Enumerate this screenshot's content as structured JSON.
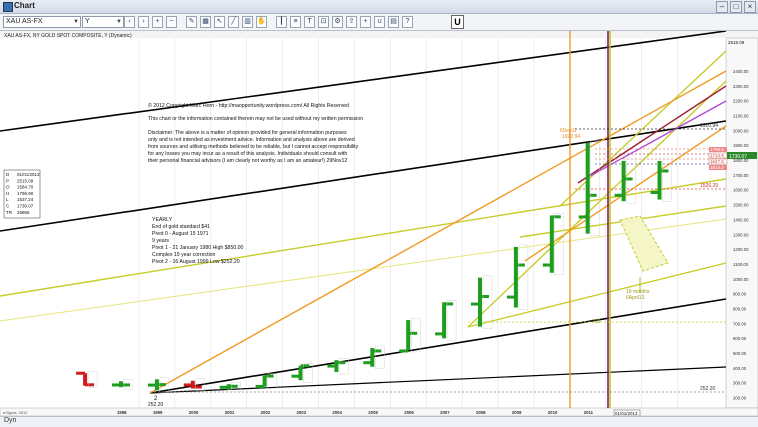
{
  "window": {
    "title": "Chart"
  },
  "toolbar": {
    "symbol": "XAU AS-FX",
    "period": "Y",
    "u_label": "U"
  },
  "chart": {
    "header": "XAU AS-FX, NY GOLD SPOT COMPOSITE, Y (Dynamic)",
    "copyright": [
      "© 2012 Copyright Marc Horn - http://maopportunity.wordpress.com/  All Rights Reserved",
      "This chart or the information contained therein may not be used without my written permission",
      "Disclaimer: The above is a matter of opinion provided for general information purposes",
      "only and is not intended as investment advice. Information and analysis above are derived",
      "from sources and utilising methods believed to be reliable, but I cannot accept responsibility",
      "for any losses you may incur as a result of this analysis. Individuals should consult with",
      "their personal financial advisors (I am clearly not worthy as I am an amateur!)    29Nov12"
    ],
    "notes": [
      "YEARLY",
      "End of gold standard $41",
      "Pivot 0 - August 15 1971",
      "9 years",
      "Pivot 1 - 21 January 1980 High $850.00",
      "Complex 19 year correction",
      "Pivot 2 - 16 August 1999 Low $252.20"
    ],
    "data_box": [
      {
        "k": "D",
        "v": "01/01/2013"
      },
      {
        "k": "P",
        "v": "2515.09"
      },
      {
        "k": "O",
        "v": "1584.70"
      },
      {
        "k": "H",
        "v": "1796.90"
      },
      {
        "k": "L",
        "v": "1537.24"
      },
      {
        "k": "C",
        "v": "1730.07"
      },
      {
        "k": "TR",
        "v": "26866"
      }
    ],
    "annotations": {
      "high_label_1": "6Sep11",
      "high_label_2": "1920.94",
      "low_label": "252.20",
      "pivot_num": "2",
      "bottom_price": "252.20",
      "months_1": "19 months",
      "months_2": "6April13",
      "price_1920": "1920.94",
      "price_1526": "1526.29",
      "price_current": "1730.07",
      "price_red1": "1798.5",
      "price_red2": "1714.9",
      "price_red3": "1647.5",
      "price_red4": "1614.3",
      "watermark": "eSignal, 2012",
      "date_box": "01/01/2013",
      "right_top": "2515.09",
      "price_700": "700"
    },
    "x_labels": [
      "1998",
      "1999",
      "2000",
      "2001",
      "2002",
      "2003",
      "2004",
      "2005",
      "2006",
      "2007",
      "2008",
      "2009",
      "2010",
      "2011",
      "2012"
    ],
    "y_labels": [
      "2400.00",
      "2300.00",
      "2200.00",
      "2100.00",
      "2000.00",
      "1900.00",
      "1800.00",
      "1700.00",
      "1600.00",
      "1500.00",
      "1400.00",
      "1300.00",
      "1200.00",
      "1100.00",
      "1000.00",
      "900.00",
      "800.00",
      "700.00",
      "600.00",
      "500.00",
      "400.00",
      "300.00",
      "200.00"
    ]
  },
  "chart_data": {
    "type": "ohlc",
    "x": [
      1997,
      1998,
      1999,
      2000,
      2001,
      2002,
      2003,
      2004,
      2005,
      2006,
      2007,
      2008,
      2009,
      2010,
      2011,
      2012,
      2013
    ],
    "open": [
      367,
      288,
      287,
      288,
      272,
      278,
      347,
      415,
      438,
      517,
      632,
      833,
      880,
      1096,
      1420,
      1566,
      1585
    ],
    "high": [
      367,
      313,
      326,
      316,
      293,
      350,
      417,
      455,
      537,
      725,
      845,
      1011,
      1218,
      1430,
      1920,
      1798,
      1797
    ],
    "low": [
      283,
      273,
      252,
      264,
      255,
      277,
      320,
      375,
      411,
      524,
      602,
      681,
      810,
      1044,
      1308,
      1526,
      1537
    ],
    "close": [
      289,
      288,
      290,
      274,
      279,
      348,
      417,
      438,
      517,
      636,
      834,
      884,
      1096,
      1421,
      1566,
      1676,
      1730
    ],
    "colors": {
      "up": "#1e9e1e",
      "down": "#d21a1a"
    },
    "ylim": [
      200,
      2500
    ]
  },
  "tools": [
    "prev-icon",
    "next-icon",
    "zoom-in-icon",
    "zoom-out-icon",
    "pen-icon",
    "grid-icon",
    "cursor-icon",
    "line-icon",
    "chart-icon",
    "hand-icon",
    "bar-icon",
    "fib-icon",
    "text-icon",
    "lock-icon",
    "settings-icon",
    "export-icon",
    "crosshair-icon",
    "magnet-icon",
    "print-icon",
    "help-icon"
  ],
  "status": {
    "dyn": "Dyn"
  }
}
